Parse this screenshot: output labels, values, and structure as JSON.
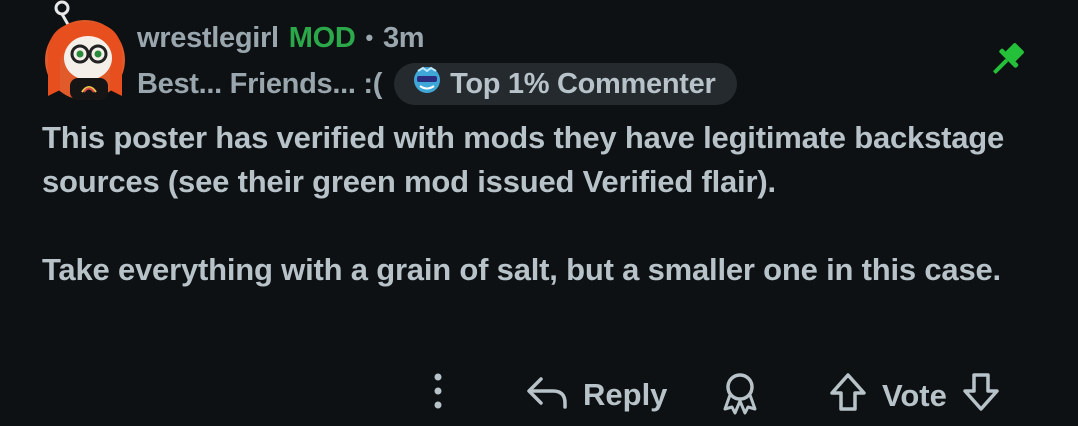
{
  "comment": {
    "username": "wrestlegirl",
    "mod_badge": "MOD",
    "separator": "•",
    "timestamp": "3m",
    "user_flair": "Best... Friends... :(",
    "badge_label": "Top 1% Commenter",
    "paragraphs": [
      "This poster has verified with mods they have legitimate backstage sources (see their green mod issued Verified flair).",
      "Take everything with a grain of salt, but a smaller one in this case."
    ]
  },
  "actions": {
    "reply_label": "Reply",
    "vote_label": "Vote"
  },
  "colors": {
    "background": "#0e1113",
    "mod_green": "#2ba84a",
    "pin_green": "#25c03a",
    "text": "#b7c3c9",
    "badge_bg": "#252a2e"
  },
  "icons": [
    "avatar",
    "pin-icon",
    "top-commenter-icon",
    "more-options-icon",
    "reply-icon",
    "award-icon",
    "upvote-icon",
    "downvote-icon"
  ]
}
